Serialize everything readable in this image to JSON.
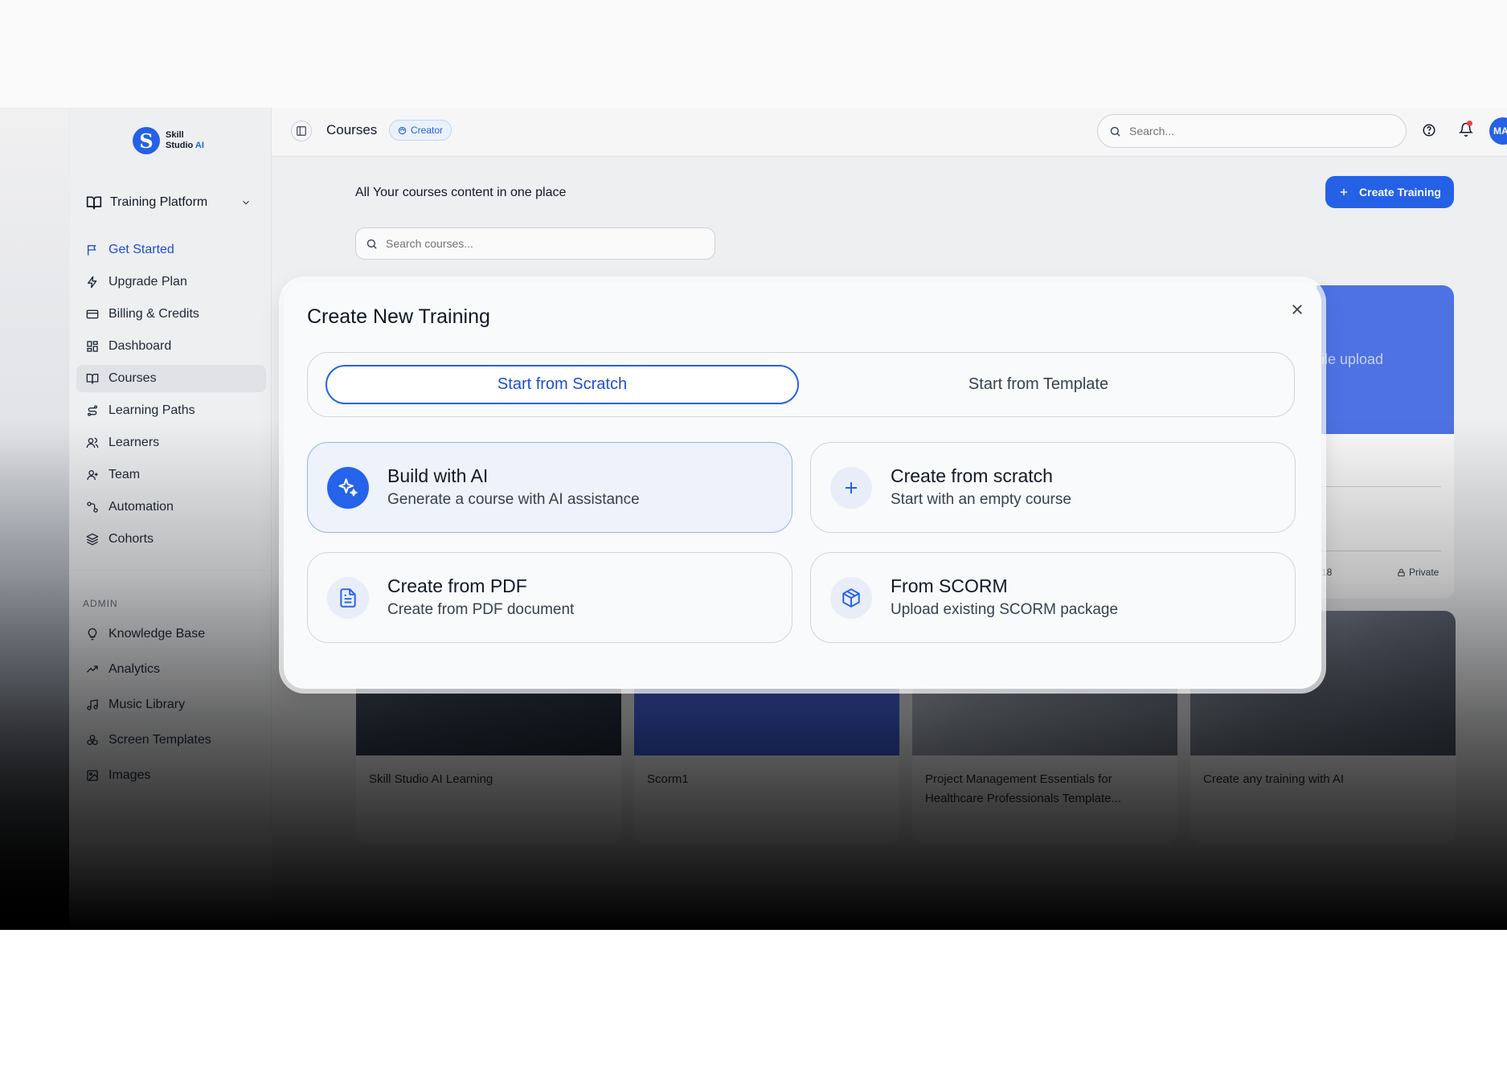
{
  "brand": {
    "line1": "Skill",
    "line2": "Studio",
    "line2_accent": "AI"
  },
  "workspace": {
    "label": "Training Platform"
  },
  "nav": [
    {
      "label": "Get Started",
      "icon": "flag-icon"
    },
    {
      "label": "Upgrade Plan",
      "icon": "bolt-icon"
    },
    {
      "label": "Billing & Credits",
      "icon": "credit-card-icon"
    },
    {
      "label": "Dashboard",
      "icon": "grid-icon"
    },
    {
      "label": "Courses",
      "icon": "book-icon"
    },
    {
      "label": "Learning Paths",
      "icon": "route-icon"
    },
    {
      "label": "Learners",
      "icon": "users-icon"
    },
    {
      "label": "Team",
      "icon": "team-icon"
    },
    {
      "label": "Automation",
      "icon": "workflow-icon"
    },
    {
      "label": "Cohorts",
      "icon": "layers-icon"
    }
  ],
  "admin": {
    "heading": "ADMIN",
    "items": [
      {
        "label": "Knowledge Base",
        "icon": "lightbulb-icon"
      },
      {
        "label": "Analytics",
        "icon": "trend-icon"
      },
      {
        "label": "Music Library",
        "icon": "music-icon"
      },
      {
        "label": "Screen Templates",
        "icon": "templates-icon"
      },
      {
        "label": "Images",
        "icon": "image-icon"
      }
    ]
  },
  "topbar": {
    "title": "Courses",
    "badge": "Creator",
    "search_placeholder": "Search...",
    "avatar": "MA"
  },
  "page": {
    "subtitle": "All Your courses content in one place",
    "create_button": "Create Training",
    "search_placeholder": "Search courses..."
  },
  "background_card": {
    "banner_text": "ile upload",
    "meta": "18",
    "visibility": "Private"
  },
  "courses": [
    {
      "title": "Skill Studio AI Learning"
    },
    {
      "title": "Scorm1"
    },
    {
      "title": "Project Management Essentials for Healthcare Professionals Template..."
    },
    {
      "title": "Create any training with AI"
    }
  ],
  "modal": {
    "title": "Create New Training",
    "tabs": [
      "Start from Scratch",
      "Start from Template"
    ],
    "options": [
      {
        "title": "Build with AI",
        "desc": "Generate a course with AI assistance",
        "icon": "sparkle-icon"
      },
      {
        "title": "Create from scratch",
        "desc": "Start with an empty course",
        "icon": "plus-icon"
      },
      {
        "title": "Create from PDF",
        "desc": "Create from PDF document",
        "icon": "document-icon"
      },
      {
        "title": "From SCORM",
        "desc": "Upload existing SCORM package",
        "icon": "package-icon"
      }
    ]
  },
  "colors": {
    "accent": "#2563eb",
    "alert": "#ef4444"
  }
}
